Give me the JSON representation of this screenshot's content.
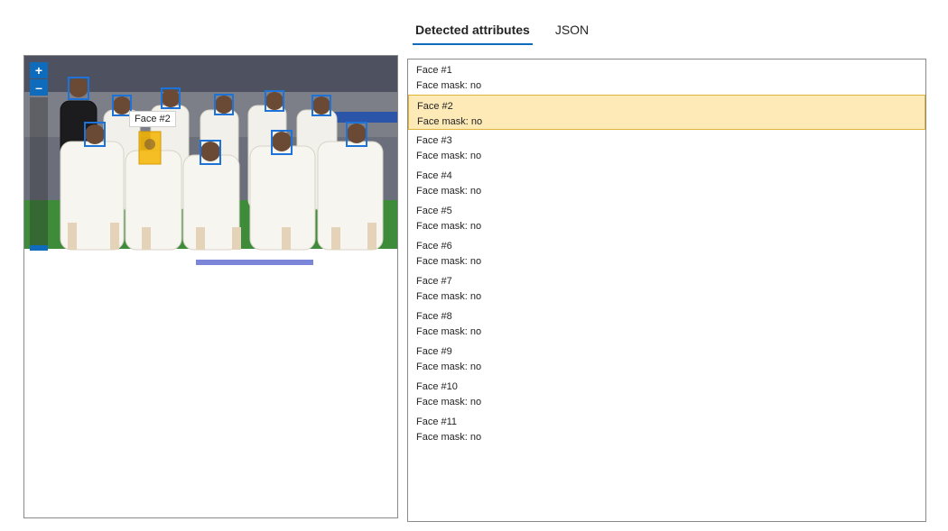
{
  "tabs": [
    {
      "label": "Detected attributes",
      "active": true
    },
    {
      "label": "JSON",
      "active": false
    }
  ],
  "viewer": {
    "zoom_in_label": "+",
    "zoom_out_label": "–",
    "tooltip": "Face #2",
    "highlight_color": "#f5b400",
    "box_color": "#1e73d8"
  },
  "faces": [
    {
      "title": "Face #1",
      "attr": "Face mask: no"
    },
    {
      "title": "Face #2",
      "attr": "Face mask: no",
      "selected": true
    },
    {
      "title": "Face #3",
      "attr": "Face mask: no"
    },
    {
      "title": "Face #4",
      "attr": "Face mask: no"
    },
    {
      "title": "Face #5",
      "attr": "Face mask: no"
    },
    {
      "title": "Face #6",
      "attr": "Face mask: no"
    },
    {
      "title": "Face #7",
      "attr": "Face mask: no"
    },
    {
      "title": "Face #8",
      "attr": "Face mask: no"
    },
    {
      "title": "Face #9",
      "attr": "Face mask: no"
    },
    {
      "title": "Face #10",
      "attr": "Face mask: no"
    },
    {
      "title": "Face #11",
      "attr": "Face mask: no"
    }
  ]
}
